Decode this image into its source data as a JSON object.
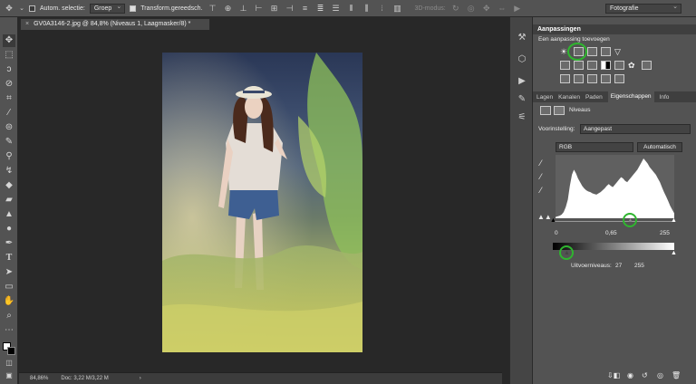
{
  "options_bar": {
    "auto_select_label": "Autom. selectie:",
    "auto_select_value": "Groep",
    "transform_label": "Transform.gereedsch.",
    "mode3d_label": "3D-modus:",
    "workspace_value": "Fotografie"
  },
  "document": {
    "tab_title": "GV0A3146-2.jpg @ 84,8% (Niveaus 1, Laagmasker/8) *",
    "tab_close": "×"
  },
  "status_bar": {
    "zoom": "84,86%",
    "doc_info": "Doc: 3,22 M/3,22 M",
    "arrow": "›"
  },
  "adjustments_panel": {
    "title": "Aanpassingen",
    "subtitle": "Een aanpassing toevoegen"
  },
  "properties_tabs": [
    "Lagen",
    "Kanalen",
    "Paden",
    "Eigenschappen",
    "Info"
  ],
  "properties": {
    "header": "Niveaus",
    "preset_label": "Voorinstelling:",
    "preset_value": "Aangepast",
    "channel_value": "RGB",
    "auto_button": "Automatisch",
    "input_levels": {
      "black": "0",
      "gamma": "0,65",
      "white": "255"
    },
    "output_label": "Uitvoerniveaus:",
    "output_levels": {
      "black": "27",
      "white": "255"
    }
  },
  "histogram": [
    2,
    3,
    4,
    6,
    10,
    18,
    30,
    52,
    70,
    78,
    72,
    64,
    58,
    52,
    48,
    45,
    43,
    42,
    40,
    39,
    38,
    40,
    42,
    45,
    48,
    52,
    55,
    52,
    50,
    54,
    58,
    62,
    66,
    64,
    60,
    58,
    62,
    66,
    70,
    74,
    78,
    84,
    90,
    96,
    92,
    88,
    82,
    78,
    74,
    70,
    64,
    58,
    50,
    42,
    35,
    28,
    20,
    14,
    8
  ],
  "colors": {
    "ui_bg": "#535353",
    "canvas_bg": "#282828",
    "highlight": "#2fb52f"
  },
  "icons": {
    "move_tool": "move-icon",
    "tools": [
      "move-icon",
      "marquee-icon",
      "lasso-icon",
      "quick-select-icon",
      "crop-icon",
      "eyedropper-icon",
      "healing-icon",
      "brush-icon",
      "stamp-icon",
      "history-brush-icon",
      "eraser-icon",
      "gradient-icon",
      "blur-icon",
      "dodge-icon",
      "pen-icon",
      "type-icon",
      "path-select-icon",
      "shape-icon",
      "hand-icon",
      "zoom-icon",
      "more-icon"
    ]
  }
}
